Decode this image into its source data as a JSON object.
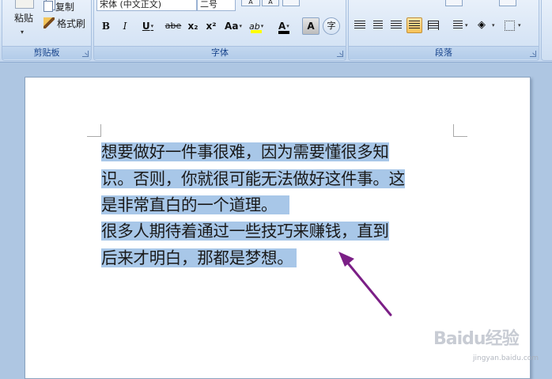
{
  "clipboard": {
    "paste_label": "粘贴",
    "copy_label": "复制",
    "format_painter_label": "格式刷",
    "group_label": "剪贴板"
  },
  "font": {
    "font_name": "宋体 (中文正文)",
    "font_size": "二号",
    "bold": "B",
    "italic": "I",
    "underline": "U",
    "strikethrough": "abe",
    "subscript": "x₂",
    "superscript": "x²",
    "change_case": "Aa",
    "highlight": "ab",
    "font_color": "A",
    "char_shading": "A",
    "enclose": "字",
    "group_label": "字体",
    "highlight_color": "#ffff00",
    "font_color_value": "#000000"
  },
  "paragraph": {
    "group_label": "段落",
    "active_alignment": "justify"
  },
  "document": {
    "lines": [
      "  想要做好一件事很难，因为需要懂很多知",
      "识。否则，你就很可能无法做好这件事。这",
      "是非常直白的一个道理。",
      "  很多人期待着通过一些技巧来赚钱，直到",
      "后来才明白，那都是梦想。"
    ],
    "selection_color": "#a8c7e8",
    "annotation_arrow_color": "#7b1f86"
  },
  "watermark": {
    "brand": "Baidu经验",
    "url": "jingyan.baidu.com"
  }
}
